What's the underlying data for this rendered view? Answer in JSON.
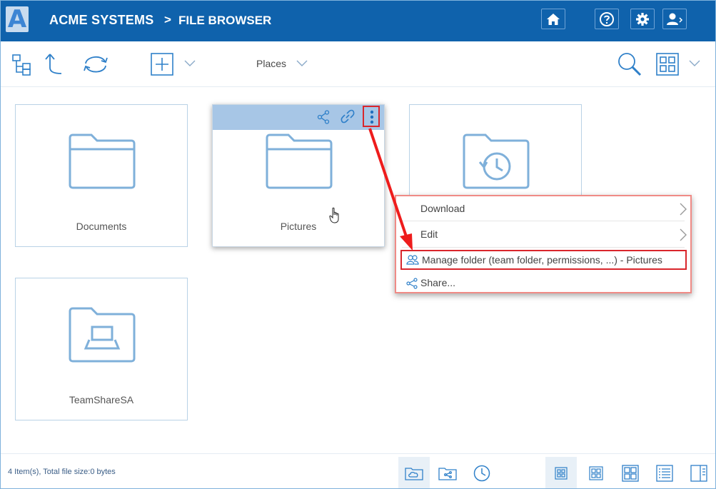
{
  "header": {
    "logo_letter": "A",
    "app_name": "ACME SYSTEMS",
    "separator": ">",
    "page_name": "FILE BROWSER",
    "buttons": [
      "home-icon",
      "help-icon",
      "gear-icon",
      "user-icon"
    ]
  },
  "toolbar": {
    "places_label": "Places",
    "icons": [
      "folder-tree-icon",
      "up-icon",
      "sync-icon",
      "add-icon",
      "chevron-down-icon",
      "search-icon",
      "grid-view-icon"
    ]
  },
  "tiles": [
    {
      "name": "Documents",
      "icon": "folder-icon"
    },
    {
      "name": "Pictures",
      "icon": "folder-icon"
    },
    {
      "name": "",
      "icon": "folder-history-icon"
    },
    {
      "name": "TeamShareSA",
      "icon": "folder-laptop-icon"
    }
  ],
  "context_menu": {
    "items": [
      {
        "label": "Download"
      },
      {
        "label": "Edit"
      },
      {
        "label": "Manage folder (team folder, permissions, ...) - Pictures"
      },
      {
        "label": "Share..."
      }
    ]
  },
  "footer": {
    "status": "4 Item(s), Total file size:0 bytes"
  },
  "colors": {
    "header_bg": "#0f62ac",
    "accent": "#2f80c9",
    "annotation_red": "#d9262c",
    "tile_bar": "#a7c6e6"
  }
}
